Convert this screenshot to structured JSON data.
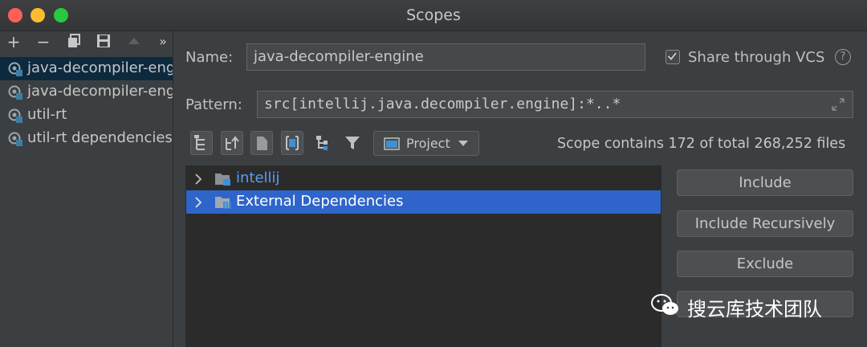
{
  "window": {
    "title": "Scopes"
  },
  "left_toolbar": {
    "add": "+",
    "remove": "−",
    "more": "»"
  },
  "scopes": [
    {
      "label": "java-decompiler-engine",
      "selected": true
    },
    {
      "label": "java-decompiler-engine",
      "selected": false
    },
    {
      "label": "util-rt",
      "selected": false
    },
    {
      "label": "util-rt dependencies",
      "selected": false
    }
  ],
  "form": {
    "name_label": "Name:",
    "name_value": "java-decompiler-engine",
    "share_label": "Share through VCS",
    "share_checked": true,
    "pattern_label": "Pattern:",
    "pattern_value": "src[intellij.java.decompiler.engine]:*..*"
  },
  "view_toolbar": {
    "project_dropdown": "Project",
    "scope_summary": "Scope contains 172 of total 268,252 files"
  },
  "tree": {
    "items": [
      {
        "label": "intellij",
        "selected": false
      },
      {
        "label": "External Dependencies",
        "selected": true
      }
    ]
  },
  "actions": {
    "include": "Include",
    "include_recursively": "Include Recursively",
    "exclude": "Exclude"
  },
  "watermark": {
    "text": "搜云库技术团队"
  },
  "colors": {
    "accent_selection": "#2f65ca",
    "link_blue": "#589df6",
    "background": "#3c3f41"
  }
}
